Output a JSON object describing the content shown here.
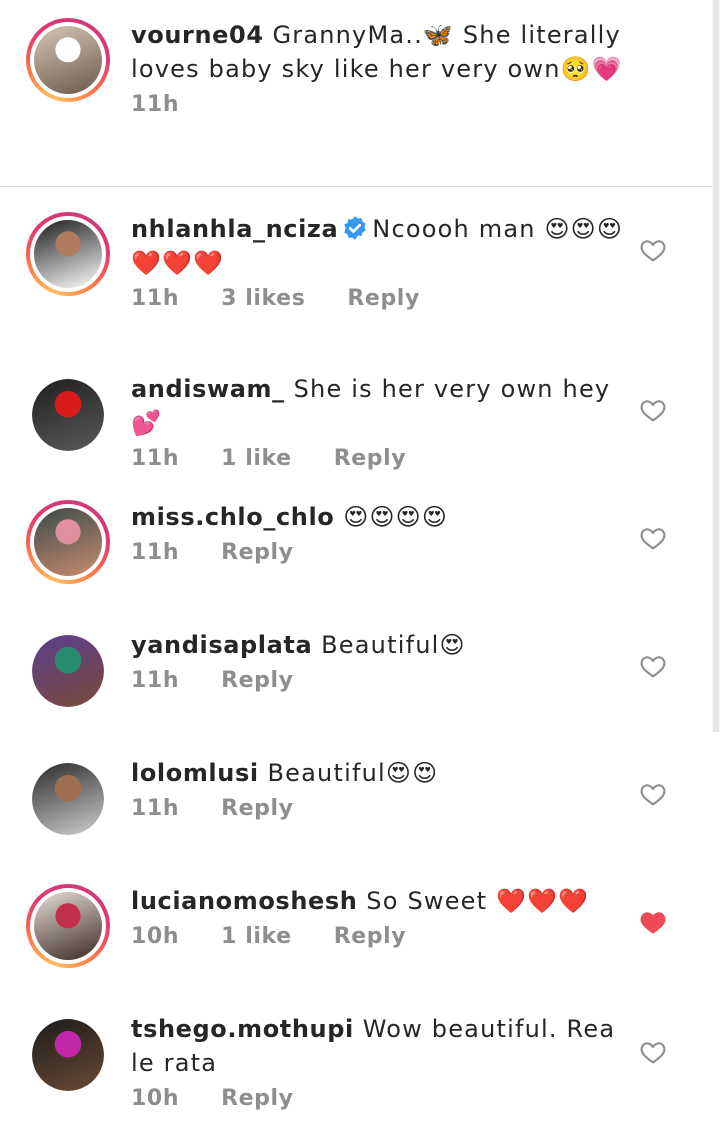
{
  "comments": [
    {
      "username": "vourne04",
      "text": "GrannyMa..🦋 She literally loves baby sky like her very own🥺💗",
      "time": "11h",
      "likes": "",
      "reply": "",
      "avatar_colors": [
        "#d6c6b6",
        "#fefefe",
        "#6b5a4b"
      ],
      "story": true,
      "verified": false,
      "liked": false,
      "show_heart": false
    },
    {
      "username": "nhlanhla_nciza",
      "text": "Ncoooh man 😍😍😍❤️❤️❤️",
      "time": "11h",
      "likes": "3 likes",
      "reply": "Reply",
      "avatar_colors": [
        "#1c1c1c",
        "#b07b5e",
        "#ffffff"
      ],
      "story": true,
      "verified": true,
      "liked": false,
      "show_heart": true
    },
    {
      "username": "andiswam_",
      "text": "She is her very own hey 💕",
      "time": "11h",
      "likes": "1 like",
      "reply": "Reply",
      "avatar_colors": [
        "#1f1f1f",
        "#d81b1b",
        "#5a5a5a"
      ],
      "story": false,
      "verified": false,
      "liked": false,
      "show_heart": true
    },
    {
      "username": "miss.chlo_chlo",
      "text": "😍😍😍😍",
      "time": "11h",
      "likes": "",
      "reply": "Reply",
      "avatar_colors": [
        "#3a4b4a",
        "#e08fa0",
        "#c98b6f"
      ],
      "story": true,
      "verified": false,
      "liked": false,
      "show_heart": true
    },
    {
      "username": "yandisaplata",
      "text": "Beautiful😍",
      "time": "11h",
      "likes": "",
      "reply": "Reply",
      "avatar_colors": [
        "#5b3f8e",
        "#2a8c6e",
        "#7a4a3a"
      ],
      "story": false,
      "verified": false,
      "liked": false,
      "show_heart": true
    },
    {
      "username": "lolomlusi",
      "text": "Beautiful😍😍",
      "time": "11h",
      "likes": "",
      "reply": "Reply",
      "avatar_colors": [
        "#2b2b2b",
        "#a06e50",
        "#cfcfcf"
      ],
      "story": false,
      "verified": false,
      "liked": false,
      "show_heart": true
    },
    {
      "username": "lucianomoshesh",
      "text": "So Sweet ❤️❤️❤️",
      "time": "10h",
      "likes": "1 like",
      "reply": "Reply",
      "avatar_colors": [
        "#e6dcd6",
        "#c22f4a",
        "#3b2a24"
      ],
      "story": true,
      "verified": false,
      "liked": true,
      "show_heart": true
    },
    {
      "username": "tshego.mothupi",
      "text": "Wow beautiful. Rea le rata",
      "time": "10h",
      "likes": "",
      "reply": "Reply",
      "avatar_colors": [
        "#1c1c1c",
        "#c028a8",
        "#6a4a34"
      ],
      "story": false,
      "verified": false,
      "liked": false,
      "show_heart": true
    }
  ],
  "colors": {
    "accent_like": "#ed4956",
    "verified": "#3897f0",
    "meta": "#8e8e8e",
    "text": "#262626",
    "story_ring": "#e43a6f"
  },
  "icons": {
    "heart": "heart-icon",
    "heart_filled": "heart-filled-icon",
    "verified": "verified-badge-icon"
  }
}
